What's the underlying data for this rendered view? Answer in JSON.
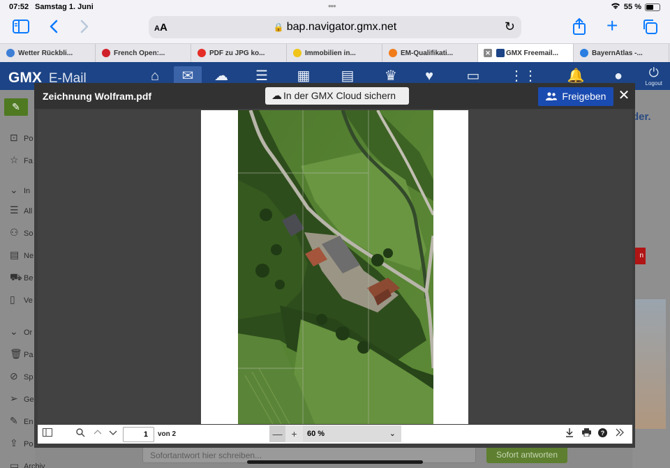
{
  "status": {
    "time": "07:52",
    "date": "Samstag 1. Juni",
    "battery": "55 %",
    "battery_level": 0.55
  },
  "browser": {
    "url": "bap.navigator.gmx.net",
    "aa": "AA",
    "tabs": [
      {
        "label": "Wetter Rückbli...",
        "color": "#3e7fd6"
      },
      {
        "label": "French Open:...",
        "color": "#d0202a"
      },
      {
        "label": "PDF zu JPG ko...",
        "color": "#e52d27"
      },
      {
        "label": "Immobilien in...",
        "color": "#f0c419"
      },
      {
        "label": "EM-Qualifikati...",
        "color": "#f07c1a"
      },
      {
        "label": "GMX Freemail...",
        "color": "#1c4486"
      },
      {
        "label": "BayernAtlas -...",
        "color": "#2a7de1"
      }
    ]
  },
  "gmx": {
    "logo": "GMX",
    "logo_sub": "E-Mail",
    "logout": "Logout",
    "nav_icons": [
      "home-icon",
      "mail-icon",
      "cloud-icon",
      "contacts-icon",
      "calendar-icon",
      "office-icon",
      "crown-icon",
      "health-icon",
      "tv-icon",
      "apps-icon",
      "bell-icon",
      "user-icon"
    ]
  },
  "background": {
    "sidebar": [
      {
        "icon": "inbox-icon",
        "label": "Po"
      },
      {
        "icon": "star-icon",
        "label": "Fa"
      },
      {
        "icon": "chevron-icon",
        "label": "In"
      },
      {
        "icon": "list-icon",
        "label": "All"
      },
      {
        "icon": "social-icon",
        "label": "So"
      },
      {
        "icon": "news-icon",
        "label": "Ne"
      },
      {
        "icon": "cart-icon",
        "label": "Be"
      },
      {
        "icon": "doc-icon",
        "label": "Ve"
      },
      {
        "icon": "chevron-icon",
        "label": "Or"
      },
      {
        "icon": "trash-icon",
        "label": "Pa"
      },
      {
        "icon": "spam-icon",
        "label": "Sp"
      },
      {
        "icon": "send-icon",
        "label": "Ge"
      },
      {
        "icon": "draft-icon",
        "label": "En"
      },
      {
        "icon": "outbox-icon",
        "label": "Po"
      },
      {
        "icon": "archive-icon",
        "label": "Archiv"
      }
    ],
    "ad_text": "der.",
    "ad_button": "n",
    "reply_placeholder": "Sofortantwort hier schreiben...",
    "reply_button": "Sofort antworten"
  },
  "viewer": {
    "title": "Zeichnung Wolfram.pdf",
    "cloud_button": "In der GMX Cloud sichern",
    "share_button": "Freigeben",
    "page_current": "1",
    "page_total_label": "von 2",
    "zoom": "60 %"
  }
}
